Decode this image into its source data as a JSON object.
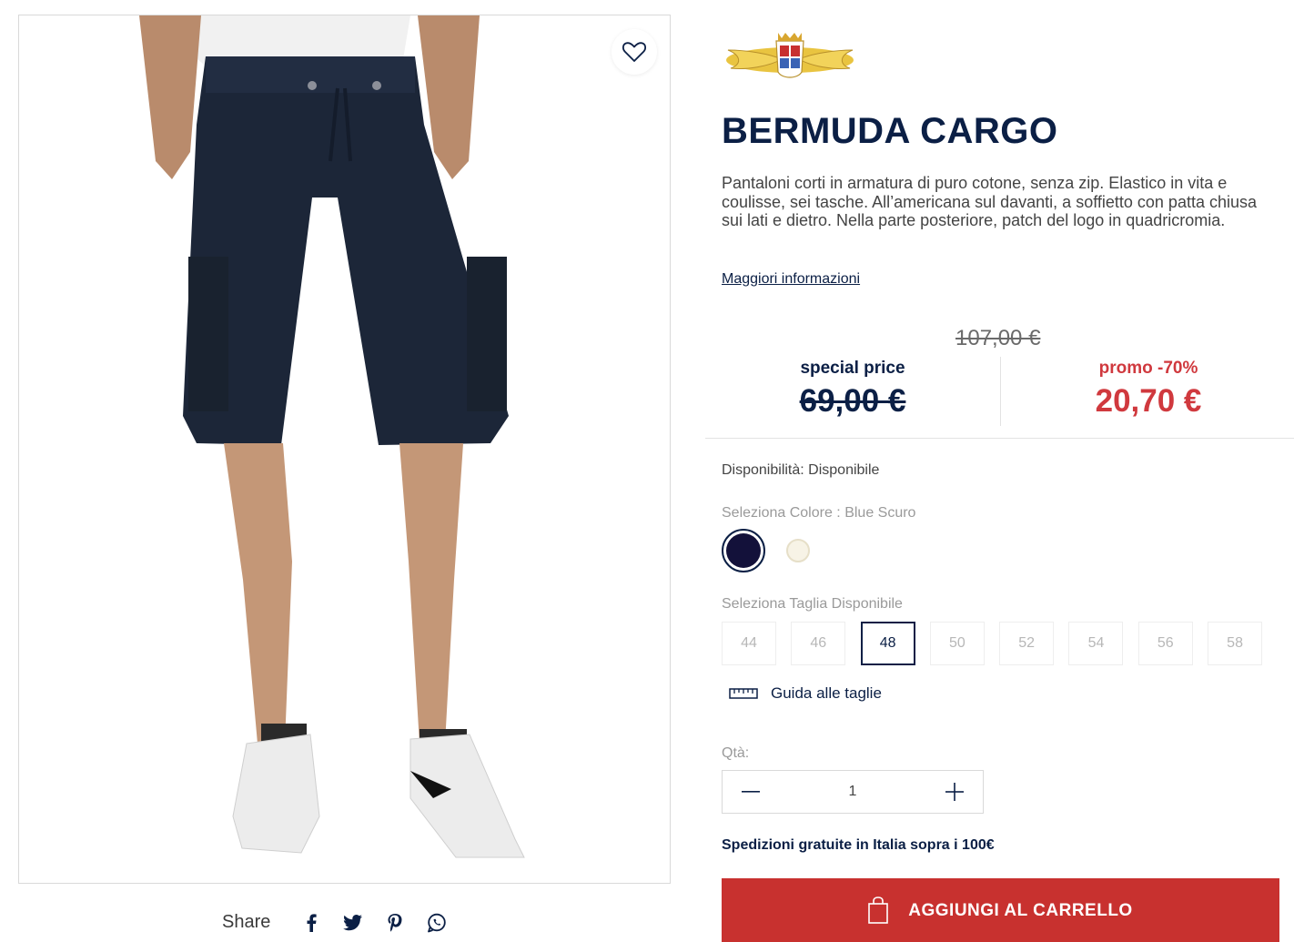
{
  "product": {
    "title": "BERMUDA CARGO",
    "description": "Pantaloni corti in armatura di puro cotone, senza zip. Elastico in vita e coulisse, sei tasche. All’americana sul davanti, a soffietto con patta chiusa sui lati e dietro. Nella parte posteriore, patch del logo in quadricromia.",
    "more_info": "Maggiori informazioni"
  },
  "pricing": {
    "original": "107,00 €",
    "special_label": "special price",
    "special_value": "69,00 €",
    "promo_label": "promo -70%",
    "promo_value": "20,70 €"
  },
  "availability": "Disponibilità: Disponibile",
  "color": {
    "label": "Seleziona Colore : Blue Scuro",
    "options": [
      {
        "name": "Blue Scuro",
        "hex": "#13113a",
        "selected": true
      },
      {
        "name": "cream",
        "hex": "#f7f3e6",
        "selected": false
      }
    ]
  },
  "size": {
    "label": "Seleziona Taglia Disponibile",
    "options": [
      "44",
      "46",
      "48",
      "50",
      "52",
      "54",
      "56",
      "58"
    ],
    "selected": "48"
  },
  "size_guide": "Guida alle taglie",
  "quantity": {
    "label": "Qtà:",
    "value": "1"
  },
  "shipping_note": "Spedizioni gratuite in Italia sopra i 100€",
  "cart_button": "AGGIUNGI AL CARRELLO",
  "share": {
    "label": "Share",
    "icons": [
      "facebook-icon",
      "twitter-icon",
      "pinterest-icon",
      "whatsapp-icon"
    ]
  },
  "colors": {
    "navy": "#0b1f45",
    "red": "#d0393e",
    "cart": "#c8312f"
  }
}
